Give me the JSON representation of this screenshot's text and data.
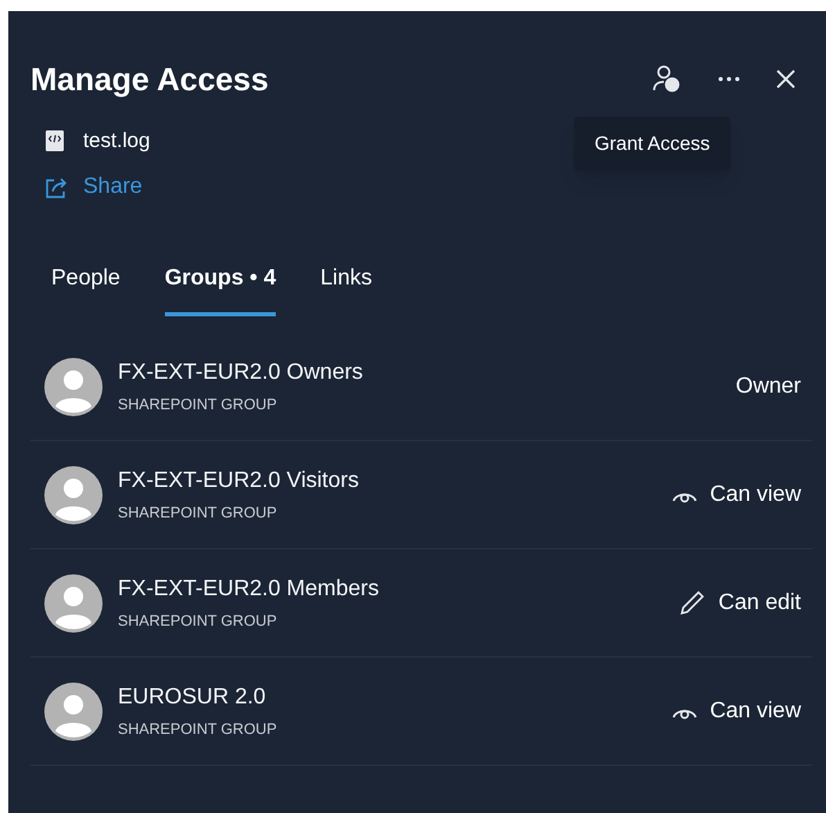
{
  "panel": {
    "title": "Manage Access",
    "tooltip": "Grant Access"
  },
  "file": {
    "name": "test.log"
  },
  "share_link": "Share",
  "tabs": [
    {
      "label": "People",
      "selected": false
    },
    {
      "label": "Groups • 4",
      "selected": true
    },
    {
      "label": "Links",
      "selected": false
    }
  ],
  "groups": [
    {
      "name": "FX-EXT-EUR2.0 Owners",
      "type": "SHAREPOINT GROUP",
      "permission": "Owner",
      "kind": "owner"
    },
    {
      "name": "FX-EXT-EUR2.0 Visitors",
      "type": "SHAREPOINT GROUP",
      "permission": "Can view",
      "kind": "view"
    },
    {
      "name": "FX-EXT-EUR2.0 Members",
      "type": "SHAREPOINT GROUP",
      "permission": "Can edit",
      "kind": "edit"
    },
    {
      "name": "EUROSUR 2.0",
      "type": "SHAREPOINT GROUP",
      "permission": "Can view",
      "kind": "view"
    }
  ]
}
